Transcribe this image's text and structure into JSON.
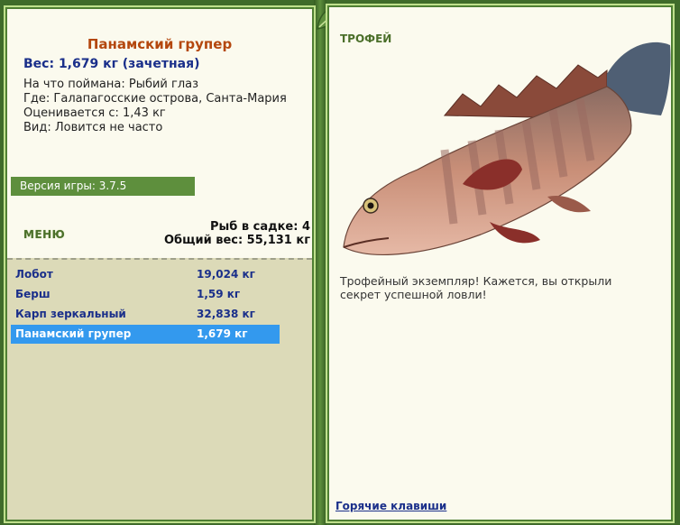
{
  "fish": {
    "name": "Панамский групер",
    "weight": "Вес: 1,679 кг (зачетная)",
    "bait": "На что поймана: Рыбий глаз",
    "location": "Где: Галапагосские острова, Санта-Мария",
    "valued_from": "Оценивается с: 1,43 кг",
    "rarity": "Вид: Ловится не часто"
  },
  "version": "Версия игры: 3.7.5",
  "menu_label": "МЕНЮ",
  "cage": {
    "count": "Рыб в садке: 4",
    "total": "Общий вес: 55,131 кг"
  },
  "catch_list": [
    {
      "name": "Лобот",
      "weight": "19,024 кг"
    },
    {
      "name": "Берш",
      "weight": "1,59 кг"
    },
    {
      "name": "Карп зеркальный",
      "weight": "32,838 кг"
    },
    {
      "name": "Панамский групер",
      "weight": "1,679 кг"
    }
  ],
  "trophy": {
    "label": "ТРОФЕЙ",
    "description": "Трофейный экземпляр! Кажется, вы открыли секрет успешной ловли!"
  },
  "hotkeys_label": "Горячие клавиши",
  "colors": {
    "frame_green": "#3f6b2a",
    "panel_bg": "#fbfaee",
    "selected_row": "#3399ee",
    "title_orange": "#b4470e",
    "link_blue": "#1a2f8a"
  }
}
